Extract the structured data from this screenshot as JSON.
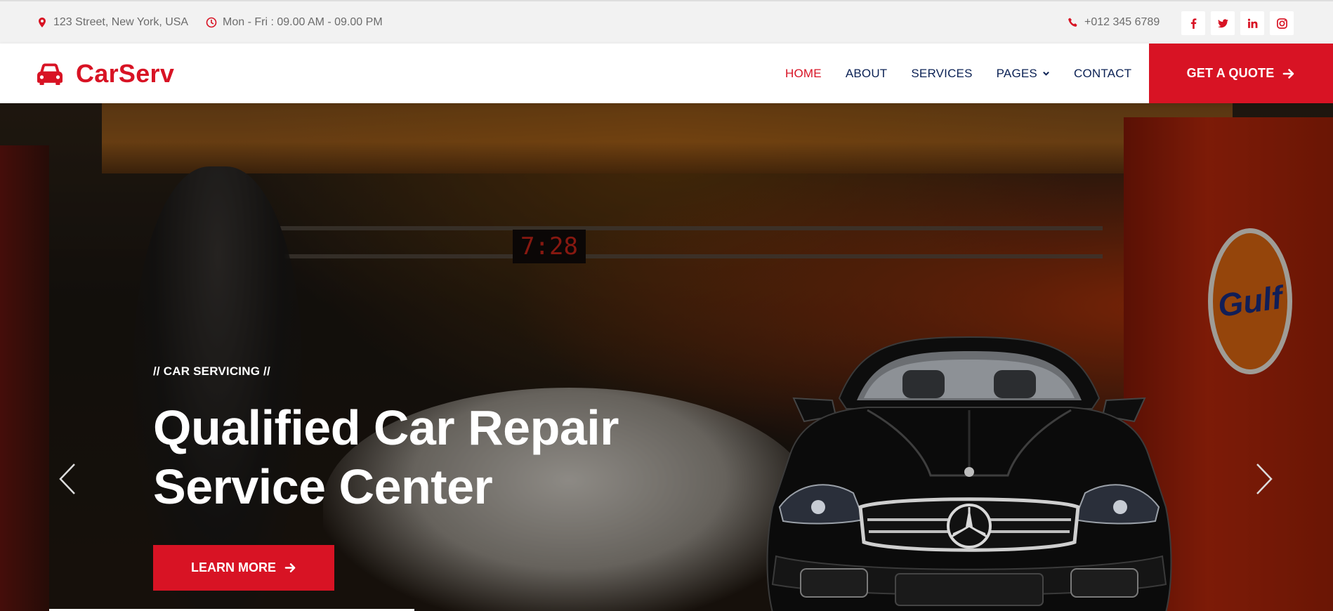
{
  "topbar": {
    "address": "123 Street, New York, USA",
    "hours": "Mon - Fri : 09.00 AM - 09.00 PM",
    "phone": "+012 345 6789",
    "socials": [
      "facebook-icon",
      "twitter-icon",
      "linkedin-icon",
      "instagram-icon"
    ]
  },
  "brand": {
    "name": "CarServ",
    "icon": "car-icon"
  },
  "nav": {
    "items": [
      {
        "label": "HOME",
        "active": true
      },
      {
        "label": "ABOUT",
        "active": false
      },
      {
        "label": "SERVICES",
        "active": false
      },
      {
        "label": "PAGES",
        "active": false,
        "dropdown": true
      },
      {
        "label": "CONTACT",
        "active": false
      }
    ],
    "cta": "GET A QUOTE"
  },
  "hero": {
    "eyebrow": "// CAR SERVICING //",
    "title_line1": "Qualified Car Repair",
    "title_line2": "Service Center",
    "button": "LEARN MORE",
    "background_clock": "7:28",
    "background_brand": "Gulf"
  },
  "colors": {
    "primary": "#d81324",
    "dark": "#0b2154",
    "topbar_bg": "#f2f2f2",
    "muted_text": "#6c6c6c"
  }
}
